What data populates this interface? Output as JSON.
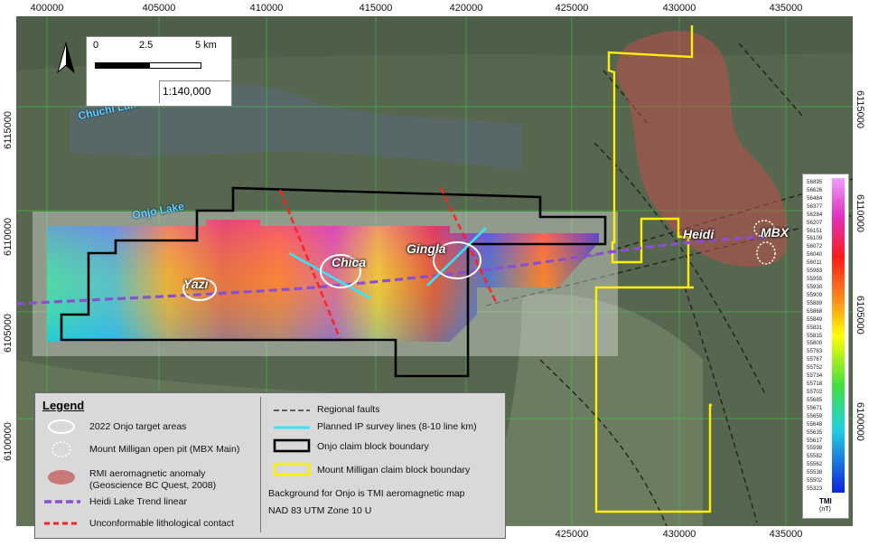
{
  "axes": {
    "x_ticks": [
      "400000",
      "405000",
      "410000",
      "415000",
      "420000",
      "425000",
      "430000",
      "435000"
    ],
    "x_ticks_bottom": [
      "425000",
      "430000",
      "435000"
    ],
    "y_ticks": [
      "6115000",
      "6110000",
      "6105000",
      "6100000"
    ]
  },
  "scale": {
    "zero": "0",
    "mid": "2.5",
    "end": "5 km",
    "ratio": "1:140,000"
  },
  "labels": {
    "chuchi": "Chuchi Lake",
    "onjo_lake": "Onjo Lake",
    "yazi": "Yazi",
    "chica": "Chica",
    "gingla": "Gingla",
    "heidi": "Heidi",
    "mbx": "MBX"
  },
  "legend": {
    "title": "Legend",
    "left_items": [
      "2022 Onjo target areas",
      "Mount Milligan open pit (MBX Main)",
      "RMI aeromagnetic anomaly",
      "(Geoscience BC Quest, 2008)",
      "Heidi Lake Trend linear",
      "Unconformable lithological contact"
    ],
    "right_items": [
      "Regional faults",
      "Planned IP survey lines (8-10 line km)",
      "Onjo claim block boundary",
      "Mount Milligan claim block boundary",
      "Background for Onjo is TMI aeromagnetic map",
      "NAD 83 UTM Zone 10 U"
    ]
  },
  "colorbar": {
    "title": "TMI",
    "unit": "(nT)",
    "values": [
      "56895",
      "56626",
      "56484",
      "56377",
      "56284",
      "56207",
      "56151",
      "56109",
      "56072",
      "56040",
      "56011",
      "55983",
      "55955",
      "55930",
      "55909",
      "55889",
      "55868",
      "55849",
      "55831",
      "55815",
      "55800",
      "55783",
      "55767",
      "55752",
      "55734",
      "55718",
      "55702",
      "55685",
      "55671",
      "55659",
      "55648",
      "55635",
      "55617",
      "55598",
      "55582",
      "55562",
      "55538",
      "55502",
      "55323"
    ]
  },
  "colors": {
    "onjo_boundary": "#000000",
    "milligan_boundary": "#ffff00",
    "ip_lines": "#33e5ff",
    "contact": "#ff2020",
    "trend": "#8a4fd1",
    "rmi": "#c0504d"
  }
}
